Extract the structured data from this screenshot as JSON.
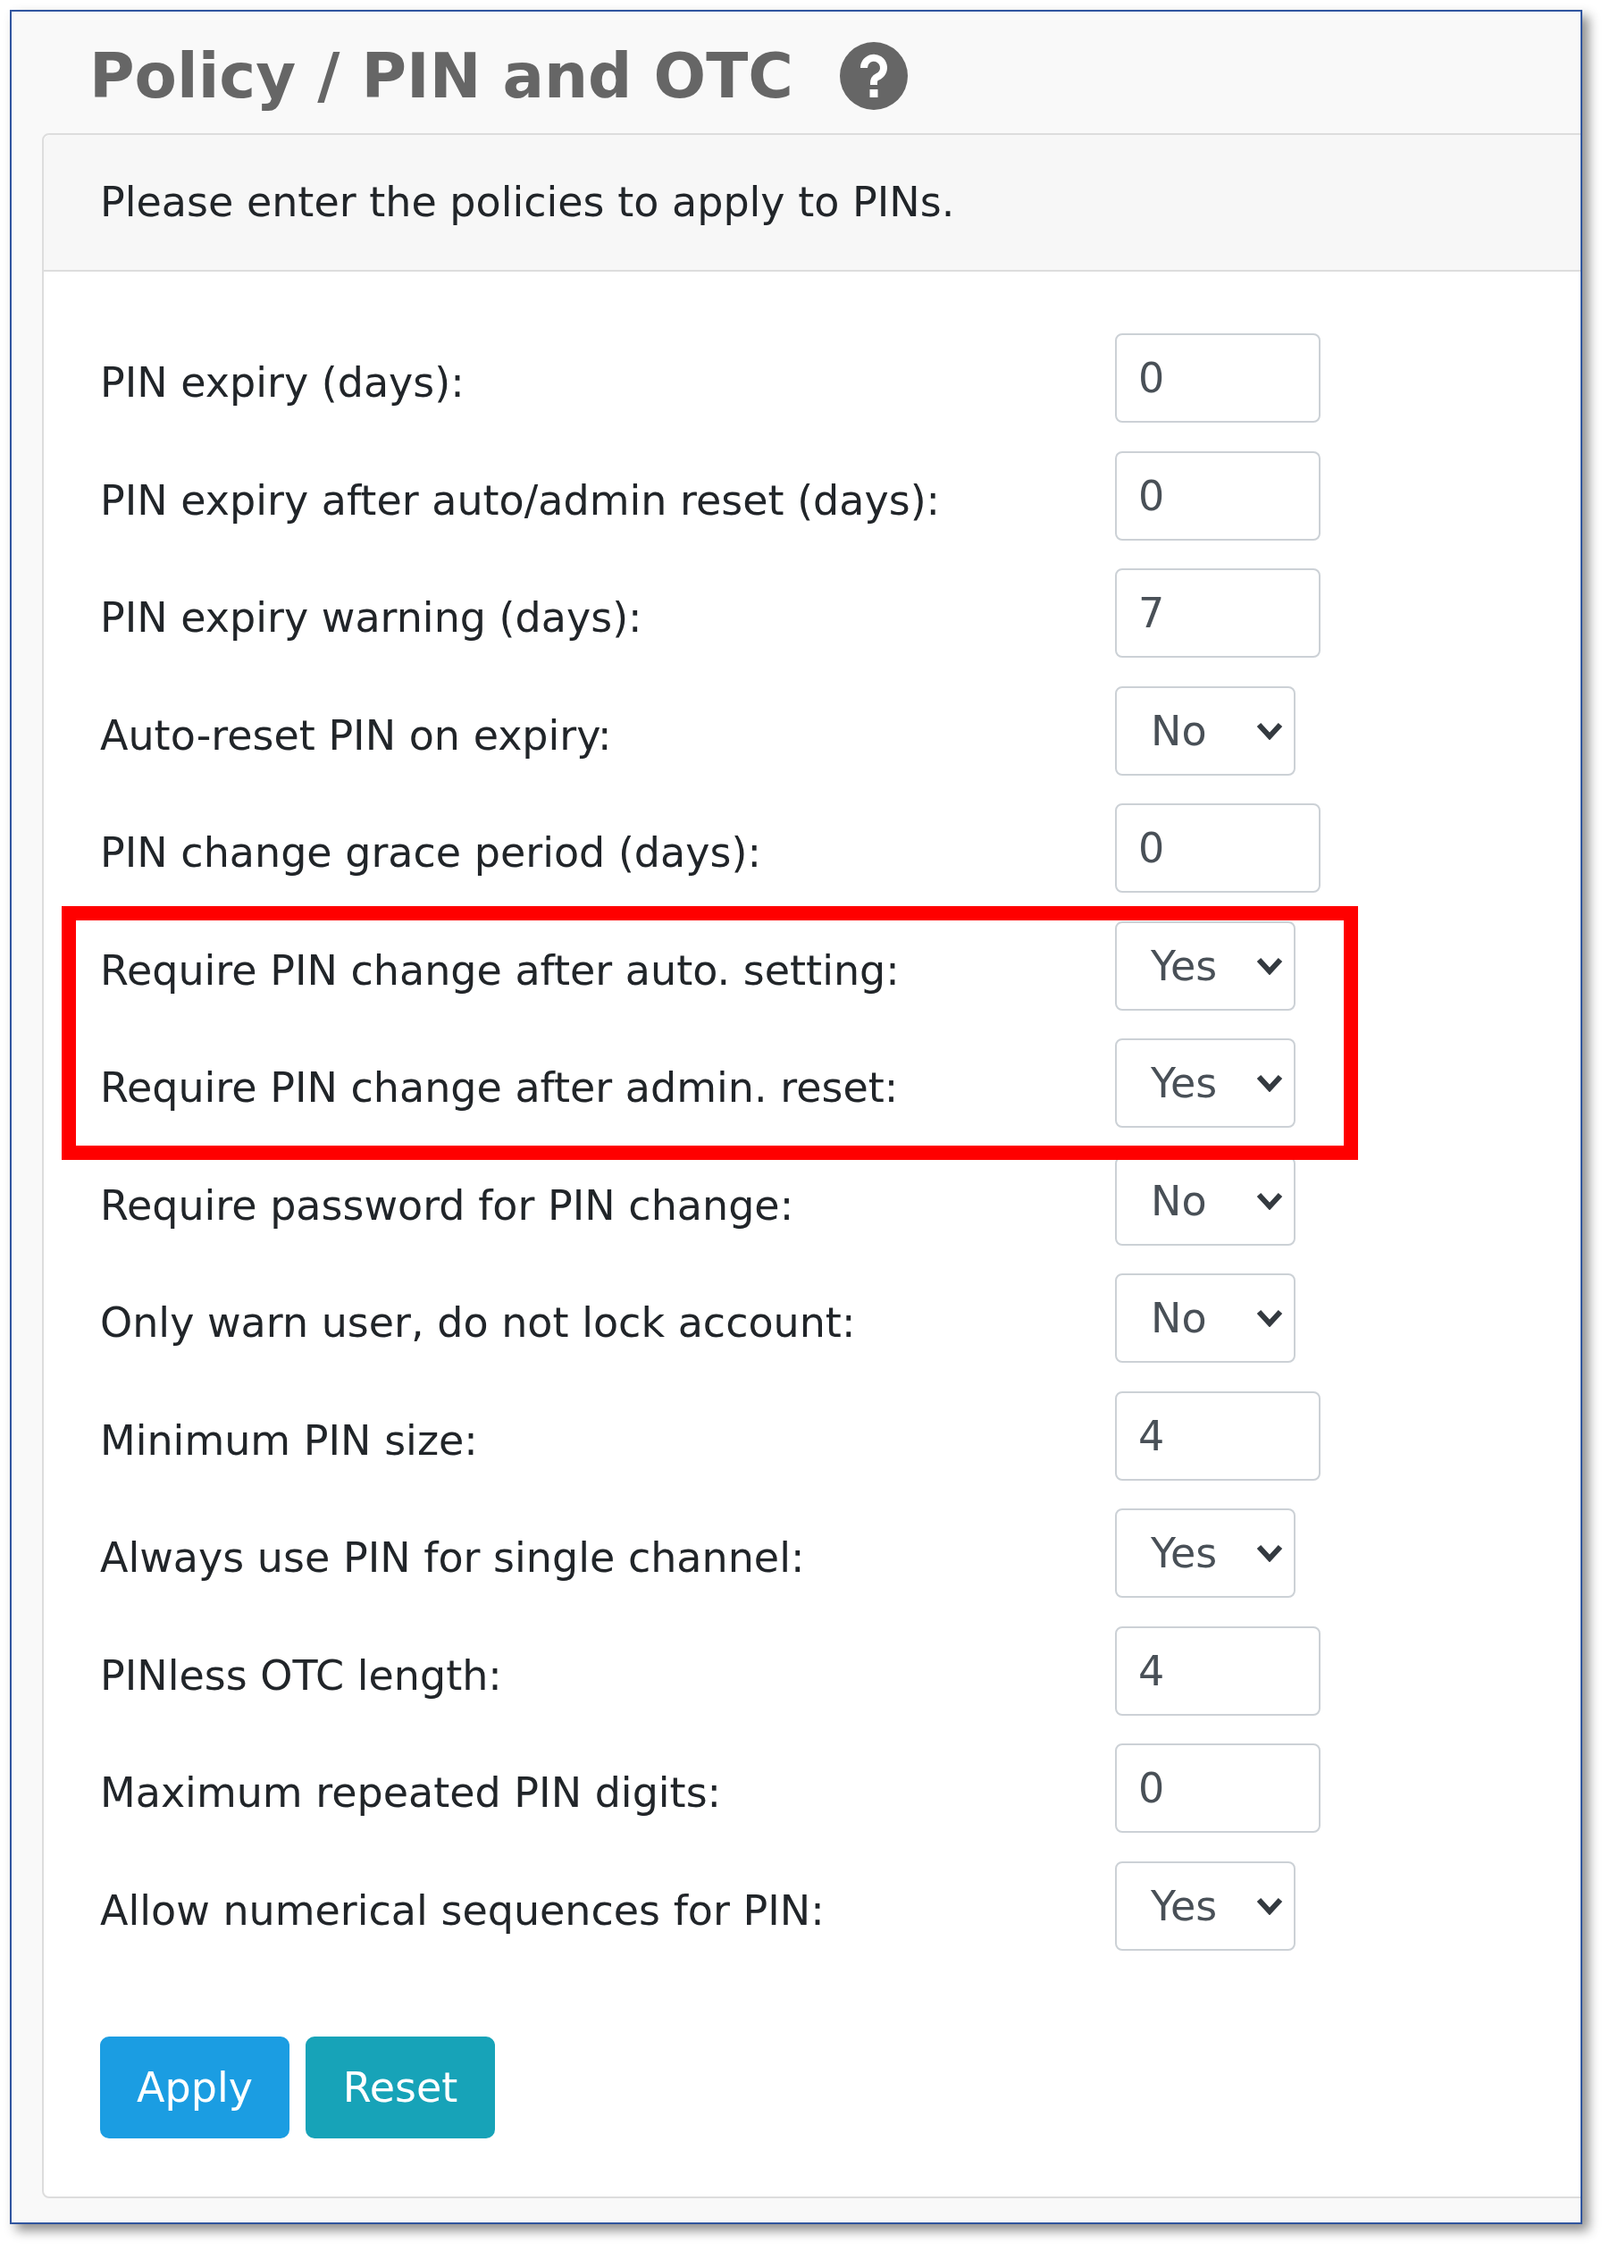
{
  "page": {
    "title": "Policy / PIN and OTC"
  },
  "card": {
    "header": "Please enter the policies to apply to PINs."
  },
  "fields": [
    {
      "kind": "text",
      "label": "PIN expiry (days):",
      "value": "0",
      "highlighted": false
    },
    {
      "kind": "text",
      "label": "PIN expiry after auto/admin reset (days):",
      "value": "0",
      "highlighted": false
    },
    {
      "kind": "text",
      "label": "PIN expiry warning (days):",
      "value": "7",
      "highlighted": false
    },
    {
      "kind": "select",
      "label": "Auto-reset PIN on expiry:",
      "value": "No",
      "highlighted": false
    },
    {
      "kind": "text",
      "label": "PIN change grace period (days):",
      "value": "0",
      "highlighted": false
    },
    {
      "kind": "select",
      "label": "Require PIN change after auto. setting:",
      "value": "Yes",
      "highlighted": true
    },
    {
      "kind": "select",
      "label": "Require PIN change after admin. reset:",
      "value": "Yes",
      "highlighted": true
    },
    {
      "kind": "select",
      "label": "Require password for PIN change:",
      "value": "No",
      "highlighted": false
    },
    {
      "kind": "select",
      "label": "Only warn user, do not lock account:",
      "value": "No",
      "highlighted": false
    },
    {
      "kind": "text",
      "label": "Minimum PIN size:",
      "value": "4",
      "highlighted": false
    },
    {
      "kind": "select",
      "label": "Always use PIN for single channel:",
      "value": "Yes",
      "highlighted": false
    },
    {
      "kind": "text",
      "label": "PINless OTC length:",
      "value": "4",
      "highlighted": false
    },
    {
      "kind": "text",
      "label": "Maximum repeated PIN digits:",
      "value": "0",
      "highlighted": false
    },
    {
      "kind": "select",
      "label": "Allow numerical sequences for PIN:",
      "value": "Yes",
      "highlighted": false
    }
  ],
  "buttons": [
    {
      "label": "Apply",
      "kind": "primary"
    },
    {
      "label": "Reset",
      "kind": "info"
    }
  ]
}
